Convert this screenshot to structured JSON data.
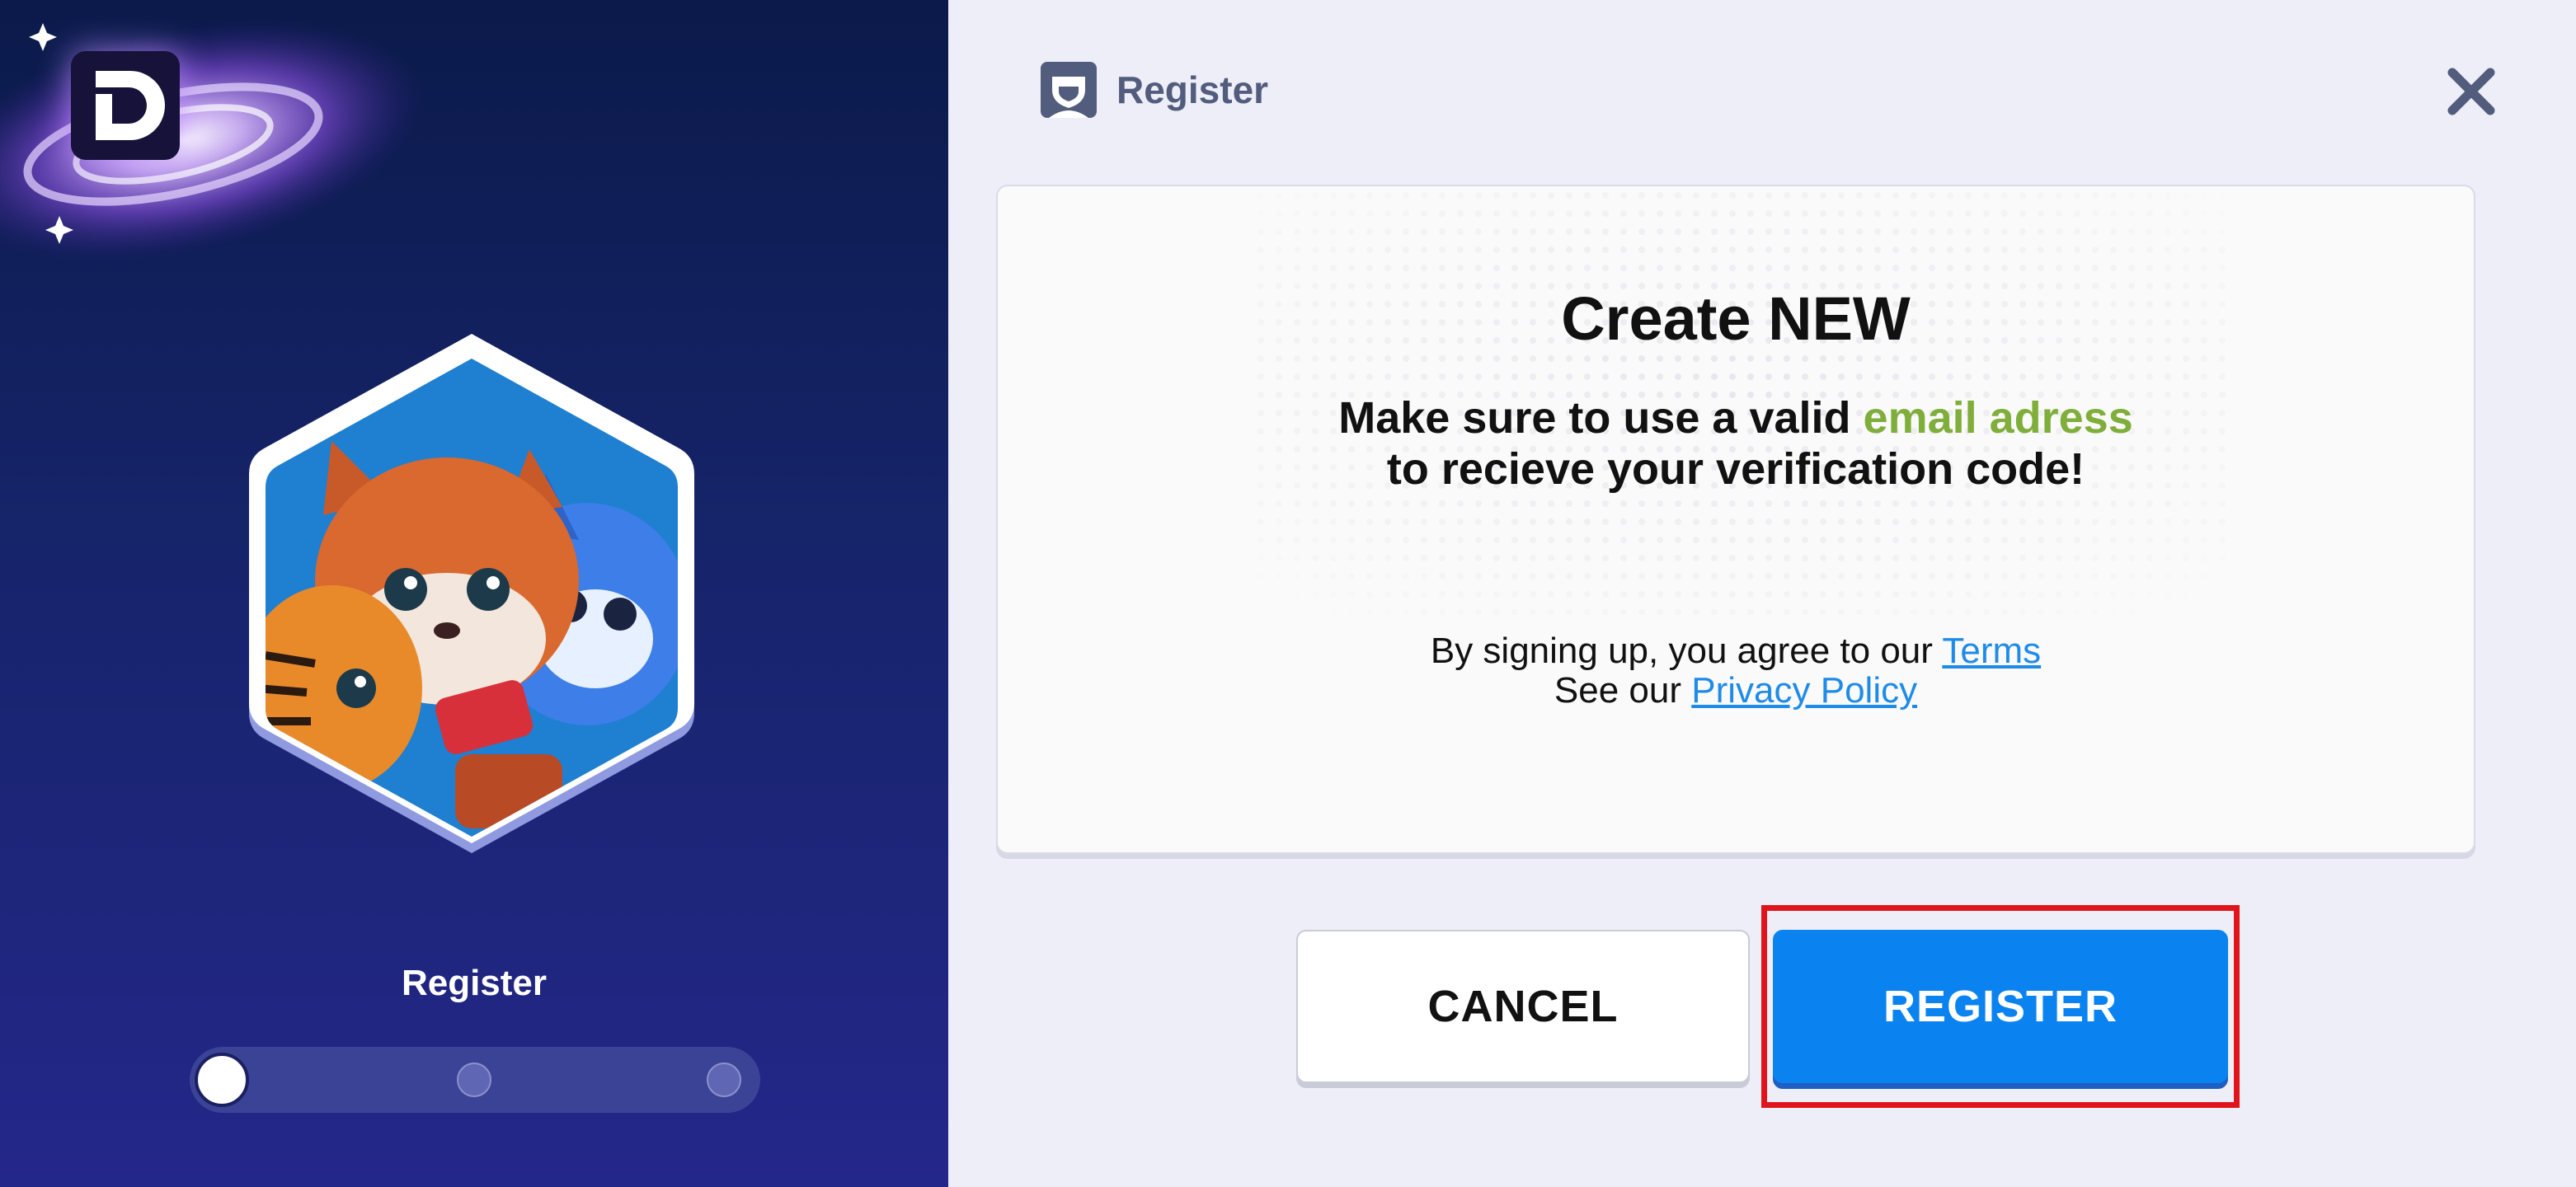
{
  "sidebar": {
    "logo_icon": "id-logo-icon",
    "title": "Register",
    "progress": {
      "current_step": 1,
      "total_steps": 3
    }
  },
  "header": {
    "title": "Register",
    "icon": "register-avatar-icon",
    "close_icon": "close-icon"
  },
  "card": {
    "title": "Create NEW",
    "subtitle_part1": "Make sure to use a valid ",
    "subtitle_highlight": "email adress",
    "subtitle_part2": "to recieve your verification code!",
    "terms_prefix": "By signing up, you agree to our ",
    "terms_link": "Terms",
    "privacy_prefix": "See our ",
    "privacy_link": "Privacy Policy"
  },
  "buttons": {
    "cancel": "CANCEL",
    "register": "REGISTER"
  },
  "colors": {
    "accent": "#0a83f0",
    "highlight_text": "#7fae3a",
    "link": "#1f8be8",
    "annotation": "#e0141a"
  }
}
